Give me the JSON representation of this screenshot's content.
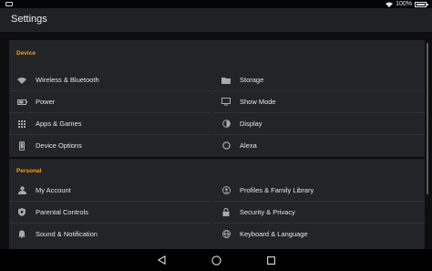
{
  "status_bar": {
    "battery_percent": "100%"
  },
  "header": {
    "title": "Settings"
  },
  "device": {
    "title": "Device",
    "left": [
      {
        "label": "Wireless & Bluetooth",
        "icon": "wifi-icon"
      },
      {
        "label": "Power",
        "icon": "battery-icon"
      },
      {
        "label": "Apps & Games",
        "icon": "apps-grid-icon"
      },
      {
        "label": "Device Options",
        "icon": "tablet-icon"
      }
    ],
    "right": [
      {
        "label": "Storage",
        "icon": "folder-icon"
      },
      {
        "label": "Show Mode",
        "icon": "monitor-icon"
      },
      {
        "label": "Display",
        "icon": "brightness-icon"
      },
      {
        "label": "Alexa",
        "icon": "alexa-ring-icon"
      }
    ]
  },
  "personal": {
    "title": "Personal",
    "left": [
      {
        "label": "My Account",
        "icon": "person-icon"
      },
      {
        "label": "Parental Controls",
        "icon": "shield-icon"
      },
      {
        "label": "Sound & Notification",
        "icon": "bell-icon"
      }
    ],
    "right": [
      {
        "label": "Profiles & Family Library",
        "icon": "profile-icon"
      },
      {
        "label": "Security & Privacy",
        "icon": "lock-icon"
      },
      {
        "label": "Keyboard & Language",
        "icon": "globe-icon"
      }
    ]
  },
  "colors": {
    "accent": "#f2a015",
    "card": "#232428",
    "background": "#0e0e10"
  }
}
